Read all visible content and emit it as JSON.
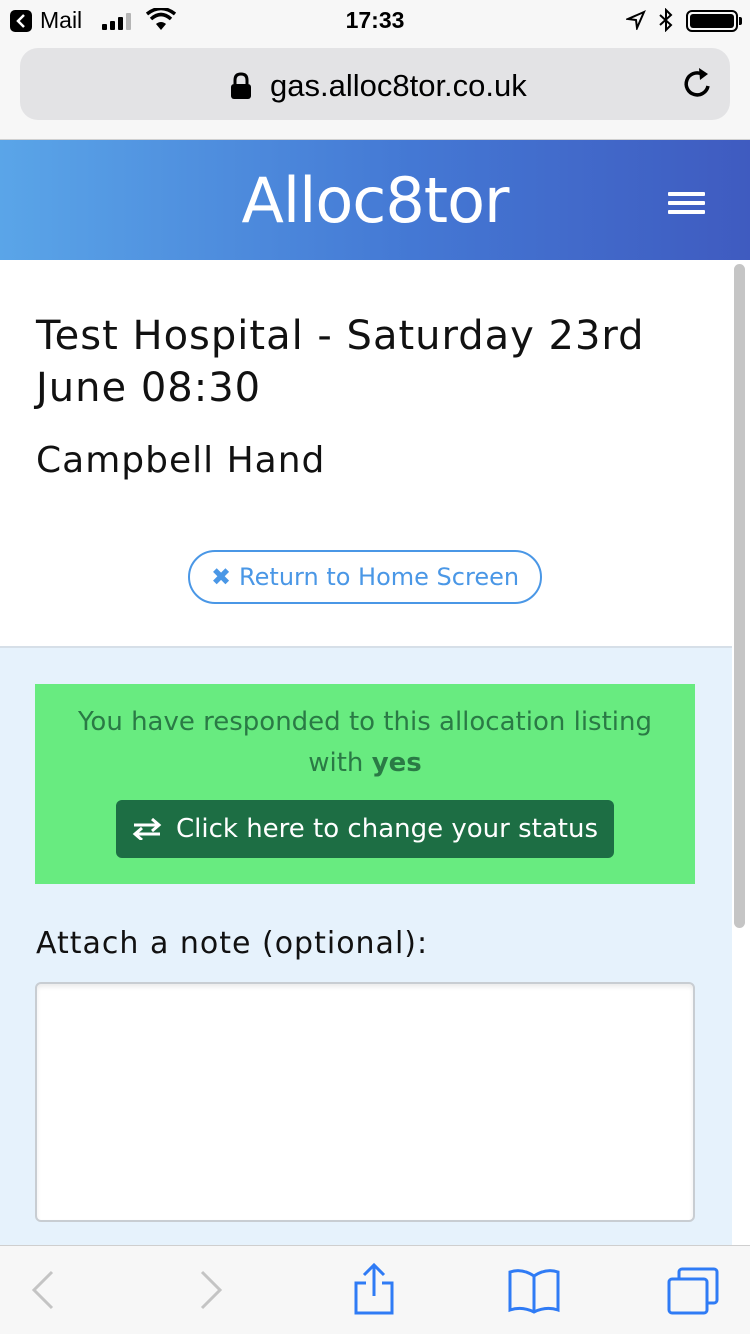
{
  "status_bar": {
    "back_app": "Mail",
    "time": "17:33"
  },
  "browser": {
    "url": "gas.alloc8tor.co.uk"
  },
  "app": {
    "logo_text": "Alloc8tor",
    "menu_icon": "hamburger-menu-icon"
  },
  "page": {
    "title": "Test Hospital - Saturday 23rd June 08:30",
    "person": "Campbell Hand",
    "return_button": "Return to Home Screen",
    "response_prefix": "You have responded to this allocation listing with",
    "response_value": "yes",
    "change_status_button": "Click here to change your status",
    "note_label": "Attach a note (optional):",
    "note_value": ""
  },
  "colors": {
    "header_start": "#5aa5e8",
    "header_end": "#3f5bc0",
    "link_blue": "#4a97e6",
    "alert_green": "#68eb80",
    "button_green": "#1d6e44",
    "panel_bg": "#e6f2fc"
  }
}
